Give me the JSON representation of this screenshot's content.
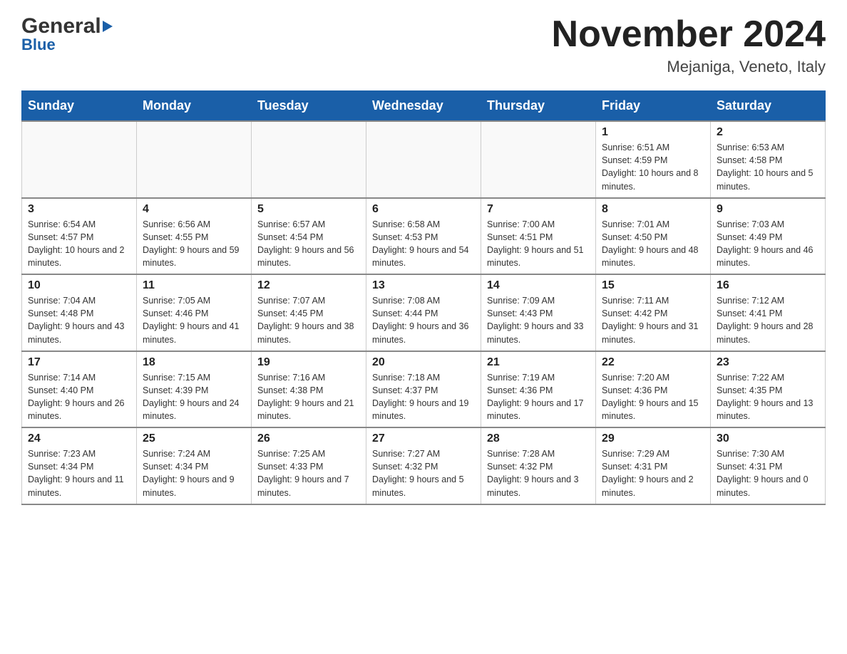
{
  "header": {
    "logo_general": "General",
    "logo_blue": "Blue",
    "month_title": "November 2024",
    "location": "Mejaniga, Veneto, Italy"
  },
  "days_of_week": [
    "Sunday",
    "Monday",
    "Tuesday",
    "Wednesday",
    "Thursday",
    "Friday",
    "Saturday"
  ],
  "weeks": [
    {
      "days": [
        {
          "number": "",
          "info": ""
        },
        {
          "number": "",
          "info": ""
        },
        {
          "number": "",
          "info": ""
        },
        {
          "number": "",
          "info": ""
        },
        {
          "number": "",
          "info": ""
        },
        {
          "number": "1",
          "info": "Sunrise: 6:51 AM\nSunset: 4:59 PM\nDaylight: 10 hours and 8 minutes."
        },
        {
          "number": "2",
          "info": "Sunrise: 6:53 AM\nSunset: 4:58 PM\nDaylight: 10 hours and 5 minutes."
        }
      ]
    },
    {
      "days": [
        {
          "number": "3",
          "info": "Sunrise: 6:54 AM\nSunset: 4:57 PM\nDaylight: 10 hours and 2 minutes."
        },
        {
          "number": "4",
          "info": "Sunrise: 6:56 AM\nSunset: 4:55 PM\nDaylight: 9 hours and 59 minutes."
        },
        {
          "number": "5",
          "info": "Sunrise: 6:57 AM\nSunset: 4:54 PM\nDaylight: 9 hours and 56 minutes."
        },
        {
          "number": "6",
          "info": "Sunrise: 6:58 AM\nSunset: 4:53 PM\nDaylight: 9 hours and 54 minutes."
        },
        {
          "number": "7",
          "info": "Sunrise: 7:00 AM\nSunset: 4:51 PM\nDaylight: 9 hours and 51 minutes."
        },
        {
          "number": "8",
          "info": "Sunrise: 7:01 AM\nSunset: 4:50 PM\nDaylight: 9 hours and 48 minutes."
        },
        {
          "number": "9",
          "info": "Sunrise: 7:03 AM\nSunset: 4:49 PM\nDaylight: 9 hours and 46 minutes."
        }
      ]
    },
    {
      "days": [
        {
          "number": "10",
          "info": "Sunrise: 7:04 AM\nSunset: 4:48 PM\nDaylight: 9 hours and 43 minutes."
        },
        {
          "number": "11",
          "info": "Sunrise: 7:05 AM\nSunset: 4:46 PM\nDaylight: 9 hours and 41 minutes."
        },
        {
          "number": "12",
          "info": "Sunrise: 7:07 AM\nSunset: 4:45 PM\nDaylight: 9 hours and 38 minutes."
        },
        {
          "number": "13",
          "info": "Sunrise: 7:08 AM\nSunset: 4:44 PM\nDaylight: 9 hours and 36 minutes."
        },
        {
          "number": "14",
          "info": "Sunrise: 7:09 AM\nSunset: 4:43 PM\nDaylight: 9 hours and 33 minutes."
        },
        {
          "number": "15",
          "info": "Sunrise: 7:11 AM\nSunset: 4:42 PM\nDaylight: 9 hours and 31 minutes."
        },
        {
          "number": "16",
          "info": "Sunrise: 7:12 AM\nSunset: 4:41 PM\nDaylight: 9 hours and 28 minutes."
        }
      ]
    },
    {
      "days": [
        {
          "number": "17",
          "info": "Sunrise: 7:14 AM\nSunset: 4:40 PM\nDaylight: 9 hours and 26 minutes."
        },
        {
          "number": "18",
          "info": "Sunrise: 7:15 AM\nSunset: 4:39 PM\nDaylight: 9 hours and 24 minutes."
        },
        {
          "number": "19",
          "info": "Sunrise: 7:16 AM\nSunset: 4:38 PM\nDaylight: 9 hours and 21 minutes."
        },
        {
          "number": "20",
          "info": "Sunrise: 7:18 AM\nSunset: 4:37 PM\nDaylight: 9 hours and 19 minutes."
        },
        {
          "number": "21",
          "info": "Sunrise: 7:19 AM\nSunset: 4:36 PM\nDaylight: 9 hours and 17 minutes."
        },
        {
          "number": "22",
          "info": "Sunrise: 7:20 AM\nSunset: 4:36 PM\nDaylight: 9 hours and 15 minutes."
        },
        {
          "number": "23",
          "info": "Sunrise: 7:22 AM\nSunset: 4:35 PM\nDaylight: 9 hours and 13 minutes."
        }
      ]
    },
    {
      "days": [
        {
          "number": "24",
          "info": "Sunrise: 7:23 AM\nSunset: 4:34 PM\nDaylight: 9 hours and 11 minutes."
        },
        {
          "number": "25",
          "info": "Sunrise: 7:24 AM\nSunset: 4:34 PM\nDaylight: 9 hours and 9 minutes."
        },
        {
          "number": "26",
          "info": "Sunrise: 7:25 AM\nSunset: 4:33 PM\nDaylight: 9 hours and 7 minutes."
        },
        {
          "number": "27",
          "info": "Sunrise: 7:27 AM\nSunset: 4:32 PM\nDaylight: 9 hours and 5 minutes."
        },
        {
          "number": "28",
          "info": "Sunrise: 7:28 AM\nSunset: 4:32 PM\nDaylight: 9 hours and 3 minutes."
        },
        {
          "number": "29",
          "info": "Sunrise: 7:29 AM\nSunset: 4:31 PM\nDaylight: 9 hours and 2 minutes."
        },
        {
          "number": "30",
          "info": "Sunrise: 7:30 AM\nSunset: 4:31 PM\nDaylight: 9 hours and 0 minutes."
        }
      ]
    }
  ]
}
